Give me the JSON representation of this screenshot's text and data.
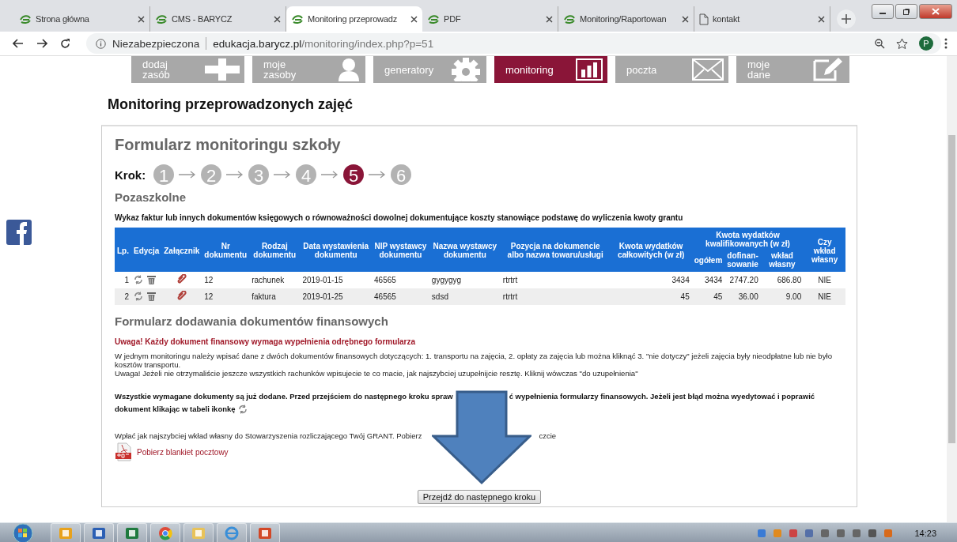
{
  "browser": {
    "tabs": [
      {
        "title": "Strona główna",
        "selected": false
      },
      {
        "title": "CMS - BARYCZ",
        "selected": false
      },
      {
        "title": "Monitoring przeprowadz",
        "selected": true
      },
      {
        "title": "PDF",
        "selected": false
      },
      {
        "title": "Monitoring/Raportowan",
        "selected": false
      },
      {
        "title": "kontakt",
        "selected": false
      }
    ],
    "security_label": "Niezabezpieczona",
    "url_host": "edukacja.barycz.pl",
    "url_path": "/monitoring/index.php?p=51",
    "profile_initial": "P"
  },
  "nav": [
    {
      "lines": [
        "dodaj",
        "zasób"
      ],
      "selected": false
    },
    {
      "lines": [
        "moje",
        "zasoby"
      ],
      "selected": false
    },
    {
      "lines": [
        "generatory"
      ],
      "selected": false
    },
    {
      "lines": [
        "monitoring"
      ],
      "selected": true
    },
    {
      "lines": [
        "poczta"
      ],
      "selected": false
    },
    {
      "lines": [
        "moje",
        "dane"
      ],
      "selected": false
    }
  ],
  "page_title": "Monitoring przeprowadzonych zajęć",
  "form": {
    "title": "Formularz monitoringu szkoły",
    "step_label": "Krok:",
    "steps": [
      {
        "label": "1",
        "selected": false
      },
      {
        "label": "2",
        "selected": false
      },
      {
        "label": "3",
        "selected": false
      },
      {
        "label": "4",
        "selected": false
      },
      {
        "label": "5",
        "selected": true
      },
      {
        "label": "6",
        "selected": false
      }
    ],
    "section": "Pozaszkolne",
    "table_caption": "Wykaz faktur lub innych dokumentów księgowych o równoważności dowolnej dokumentujące koszty stanowiące podstawę do wyliczenia kwoty grantu",
    "table": {
      "columns": [
        {
          "label": "Lp."
        },
        {
          "label": "Edycja"
        },
        {
          "label": "Załącznik"
        },
        {
          "label": "Nr dokumentu"
        },
        {
          "label": "Rodzaj dokumentu"
        },
        {
          "label": "Data wystawienia dokumentu"
        },
        {
          "label": "NIP wystawcy dokumentu"
        },
        {
          "label": "Nazwa wystawcy dokumentu"
        },
        {
          "label": "Pozycja na dokumencie albo nazwa towaru/usługi"
        },
        {
          "label": "Kwota wydatków całkowitych (w zł)"
        },
        {
          "label": "Kwota wydatków kwalifikowanych (w zł)",
          "subcolumns": [
            "ogółem",
            "dofinan-sowanie",
            "wkład własny"
          ]
        },
        {
          "label": "Czy wkład własny"
        }
      ],
      "rows": [
        {
          "lp": "1",
          "nr": "12",
          "rodzaj": "rachunek",
          "data": "2019-01-15",
          "nip": "46565",
          "nazwa": "gygygyg",
          "pozycja": "rtrtrt",
          "kwota": "3434",
          "ogolem": "3434",
          "dofinansowanie": "2747.20",
          "wklad": "686.80",
          "czy_wklad": "NIE"
        },
        {
          "lp": "2",
          "nr": "12",
          "rodzaj": "faktura",
          "data": "2019-01-25",
          "nip": "46565",
          "nazwa": "sdsd",
          "pozycja": "rtrtrt",
          "kwota": "45",
          "ogolem": "45",
          "dofinansowanie": "36.00",
          "wklad": "9.00",
          "czy_wklad": "NIE"
        }
      ]
    }
  },
  "finance_form": {
    "title": "Formularz dodawania dokumentów finansowych",
    "warning": "Uwaga! Każdy dokument finansowy wymaga wypełnienia odrębnego formularza",
    "info_lines": [
      "W jednym monitoringu należy wpisać dane z dwóch dokumentów finansowych dotyczących: 1. transportu na zajęcia, 2. opłaty za zajęcia lub można kliknąć 3. \"nie dotyczy\" jeżeli zajęcia były nieodpłatne lub nie było kosztów transportu.",
      "Uwaga! Jeżeli nie otrzymaliście jeszcze wszystkich rachunków wpisujecie te co macie, jak najszybciej uzupełnijcie resztę. Kliknij wówczas \"do uzupełnienia\""
    ],
    "status_parts": [
      "Wszystkie wymagane dokumenty są już dodane. Przed przejściem do następnego kroku spraw",
      "ć wypełnienia formularzy finansowych. Jeżeli jest błąd można wyedytować i poprawić",
      "dokument klikając w tabeli ikonkę"
    ],
    "payment_parts": [
      "Wpłać jak najszybciej wkład własny do Stowarzyszenia rozliczającego Twój GRANT. Pobierz",
      "czcie"
    ],
    "download_link": "Pobierz blankiet pocztowy",
    "next_button": "Przejdź do następnego kroku"
  },
  "taskbar": {
    "clock": "14:23"
  }
}
